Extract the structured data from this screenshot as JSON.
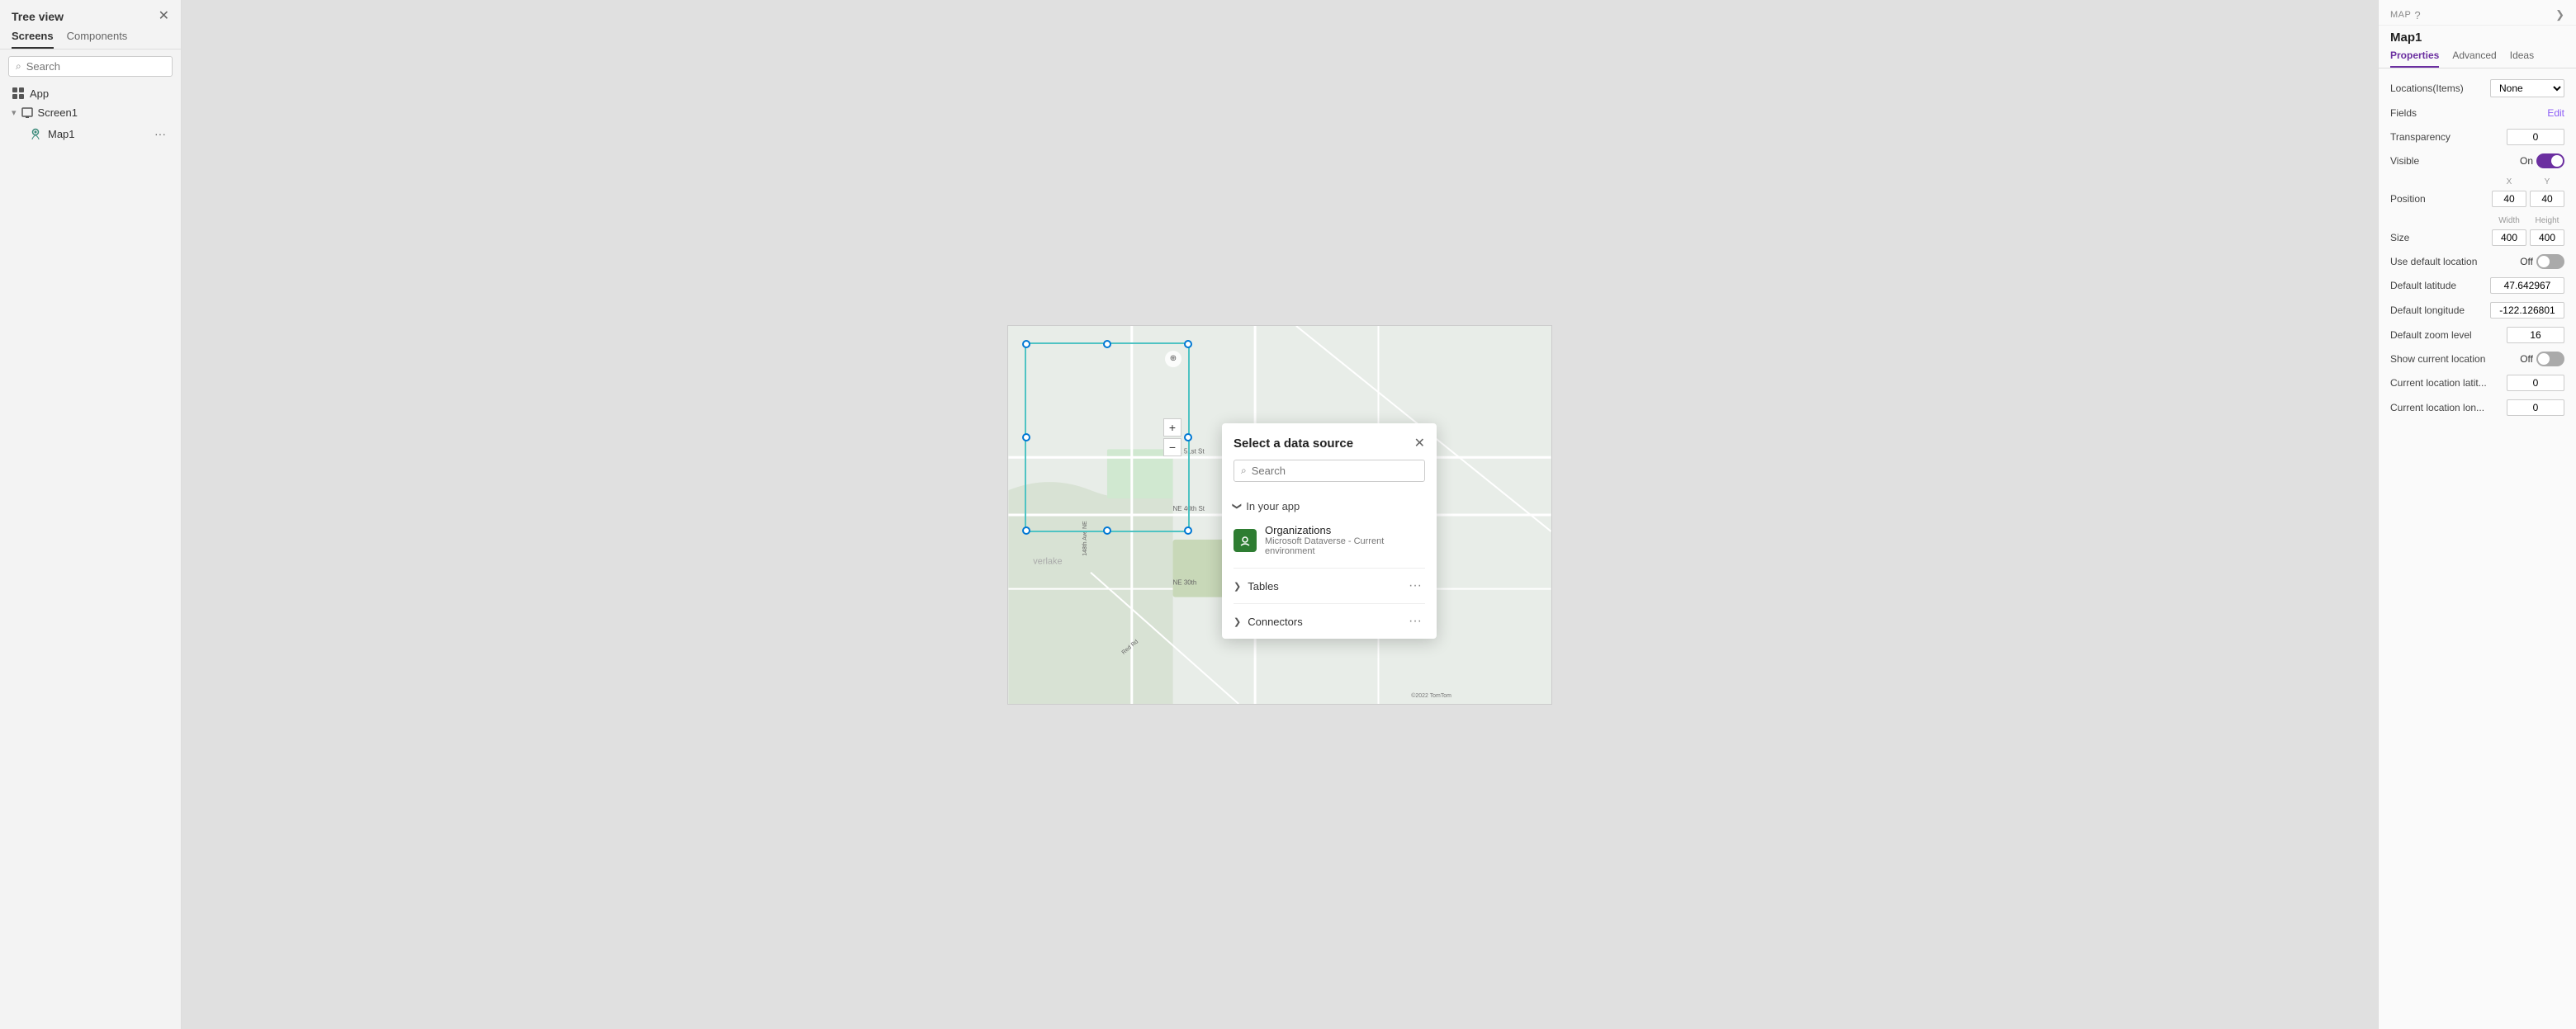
{
  "leftPanel": {
    "title": "Tree view",
    "tabs": [
      "Screens",
      "Components"
    ],
    "activeTab": "Screens",
    "search": {
      "placeholder": "Search",
      "value": ""
    },
    "items": [
      {
        "id": "app",
        "label": "App",
        "type": "app"
      },
      {
        "id": "screen1",
        "label": "Screen1",
        "type": "screen"
      },
      {
        "id": "map1",
        "label": "Map1",
        "type": "map"
      }
    ]
  },
  "modal": {
    "title": "Select a data source",
    "search": {
      "placeholder": "Search",
      "value": ""
    },
    "sections": [
      {
        "id": "inYourApp",
        "label": "In your app",
        "expanded": true,
        "items": [
          {
            "name": "Organizations",
            "subtitle": "Microsoft Dataverse - Current environment"
          }
        ]
      },
      {
        "id": "tables",
        "label": "Tables",
        "expanded": false
      },
      {
        "id": "connectors",
        "label": "Connectors",
        "expanded": false
      }
    ]
  },
  "rightPanel": {
    "label": "MAP",
    "componentName": "Map1",
    "tabs": [
      "Properties",
      "Advanced",
      "Ideas"
    ],
    "activeTab": "Properties",
    "properties": {
      "locationsItems": "None",
      "fields": "Edit",
      "transparency": "0",
      "visible": "On",
      "position": {
        "x": "40",
        "y": "40"
      },
      "size": {
        "width": "400",
        "height": "400"
      },
      "useDefaultLocation": "Off",
      "defaultLatitude": "47.642967",
      "defaultLongitude": "-122.126801",
      "defaultZoomLevel": "16",
      "showCurrentLocation": "Off",
      "currentLocationLat": "0",
      "currentLocationLon": "0"
    },
    "labels": {
      "locationsItems": "Locations(Items)",
      "fields": "Fields",
      "transparency": "Transparency",
      "visible": "Visible",
      "position": "Position",
      "size": "Size",
      "useDefaultLocation": "Use default location",
      "defaultLatitude": "Default latitude",
      "defaultLongitude": "Default longitude",
      "defaultZoomLevel": "Default zoom level",
      "showCurrentLocation": "Show current location",
      "currentLocationLat": "Current location latit...",
      "currentLocationLon": "Current location lon..."
    },
    "sublabels": {
      "x": "X",
      "y": "Y",
      "width": "Width",
      "height": "Height"
    }
  },
  "map": {
    "copyright": "©2022 TomTom",
    "streetLabel1": "NE 51st St",
    "streetLabel2": "148th Ave NE",
    "streetLabel3": "NE 40th St",
    "streetLabel4": "NE 30th",
    "streetLabel5": "Red Rd",
    "areaLabel": "verlake"
  },
  "icons": {
    "close": "✕",
    "search": "🔍",
    "chevronDown": "❯",
    "chevronRight": "❯",
    "dots": "···",
    "plus": "+",
    "minus": "−",
    "compass": "⊕",
    "questionMark": "?"
  }
}
